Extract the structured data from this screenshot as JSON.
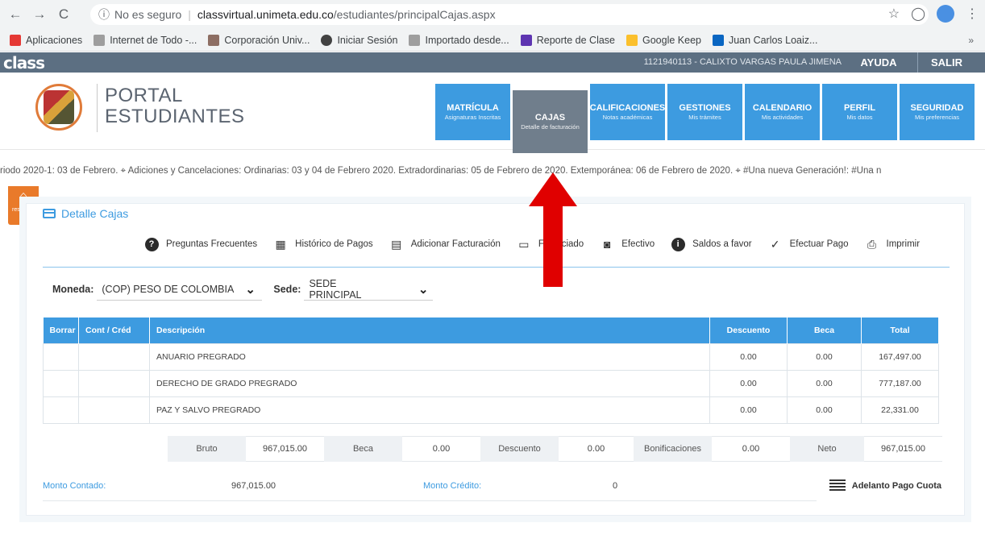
{
  "browser": {
    "security_label": "No es seguro",
    "url_host": "classvirtual.unimeta.edu.co",
    "url_path": "/estudiantes/principalCajas.aspx",
    "nav": {
      "back": "←",
      "forward": "→",
      "reload": "C",
      "info": "ⓘ"
    },
    "right": {
      "star": "☆",
      "ext": "◯",
      "menu": "⋮"
    },
    "bookmarks": [
      {
        "label": "Aplicaciones",
        "color": "#e53935"
      },
      {
        "label": "Internet de Todo -...",
        "color": "#9e9e9e"
      },
      {
        "label": "Corporación Univ...",
        "color": "#8d6e63"
      },
      {
        "label": "Iniciar Sesión",
        "color": "#424242"
      },
      {
        "label": "Importado desde...",
        "color": "#9e9e9e"
      },
      {
        "label": "Reporte de Clase",
        "color": "#5e35b1"
      },
      {
        "label": "Google Keep",
        "color": "#fbc02d"
      },
      {
        "label": "Juan Carlos Loaiz...",
        "color": "#0a66c2"
      }
    ],
    "bookmarks_more": "»"
  },
  "classbar": {
    "logo": "class",
    "user": "1121940113 - CALIXTO VARGAS PAULA JIMENA",
    "help": "AYUDA",
    "exit": "SALIR"
  },
  "portal": {
    "title_line1": "PORTAL",
    "title_line2": "ESTUDIANTES",
    "menu": [
      {
        "title": "MATRÍCULA",
        "sub": "Asignaturas Inscritas"
      },
      {
        "title": "CAJAS",
        "sub": "Detalle de facturación"
      },
      {
        "title": "CALIFICACIONES",
        "sub": "Notas académicas"
      },
      {
        "title": "GESTIONES",
        "sub": "Mis trámites"
      },
      {
        "title": "CALENDARIO",
        "sub": "Mis actividades"
      },
      {
        "title": "PERFIL",
        "sub": "Mis datos"
      },
      {
        "title": "SEGURIDAD",
        "sub": "Mis preferencias"
      }
    ]
  },
  "ticker": "riodo 2020-1: 03 de Febrero. ⌖  Adiciones y Cancelaciones:   Ordinarias: 03 y 04 de Febrero 2020. Extradordinarias: 05 de Febrero de 2020. Extemporánea: 06 de Febrero de 2020. ⌖  #Una nueva Generación!:   #Una n",
  "side_tab": {
    "label": "res Extra"
  },
  "panel": {
    "title": "Detalle Cajas",
    "actions": [
      {
        "label": "Preguntas Frecuentes",
        "icon": "question-icon"
      },
      {
        "label": "Histórico de Pagos",
        "icon": "calendar-icon"
      },
      {
        "label": "Adicionar Facturación",
        "icon": "document-icon"
      },
      {
        "label": "Financiado",
        "icon": "credit-card-icon"
      },
      {
        "label": "Efectivo",
        "icon": "cash-icon"
      },
      {
        "label": "Saldos a favor",
        "icon": "info-icon"
      },
      {
        "label": "Efectuar Pago",
        "icon": "check-circle-icon"
      },
      {
        "label": "Imprimir",
        "icon": "printer-icon"
      }
    ],
    "currency_label": "Moneda:",
    "currency_value": "(COP) PESO DE COLOMBIA",
    "site_label": "Sede:",
    "site_value": "SEDE PRINCIPAL",
    "table": {
      "headers": [
        "Borrar",
        "Cont / Créd",
        "Descripción",
        "Descuento",
        "Beca",
        "Total"
      ],
      "rows": [
        {
          "desc": "ANUARIO PREGRADO",
          "discount": "0.00",
          "scholarship": "0.00",
          "total": "167,497.00"
        },
        {
          "desc": "DERECHO DE GRADO PREGRADO",
          "discount": "0.00",
          "scholarship": "0.00",
          "total": "777,187.00"
        },
        {
          "desc": "PAZ Y SALVO PREGRADO",
          "discount": "0.00",
          "scholarship": "0.00",
          "total": "22,331.00"
        }
      ]
    },
    "totals": {
      "gross_label": "Bruto",
      "gross": "967,015.00",
      "scholarship_label": "Beca",
      "scholarship": "0.00",
      "discount_label": "Descuento",
      "discount": "0.00",
      "bonus_label": "Bonificaciones",
      "bonus": "0.00",
      "net_label": "Neto",
      "net": "967,015.00"
    },
    "summary": {
      "cash_label": "Monto Contado:",
      "cash": "967,015.00",
      "credit_label": "Monto Crédito:",
      "credit": "0",
      "advance": "Adelanto Pago Cuota"
    }
  },
  "colors": {
    "accent": "#3d9be0",
    "active_tab": "#707e8c",
    "bar": "#5c6f82",
    "orange": "#e97a2a",
    "arrow": "#e00000"
  }
}
